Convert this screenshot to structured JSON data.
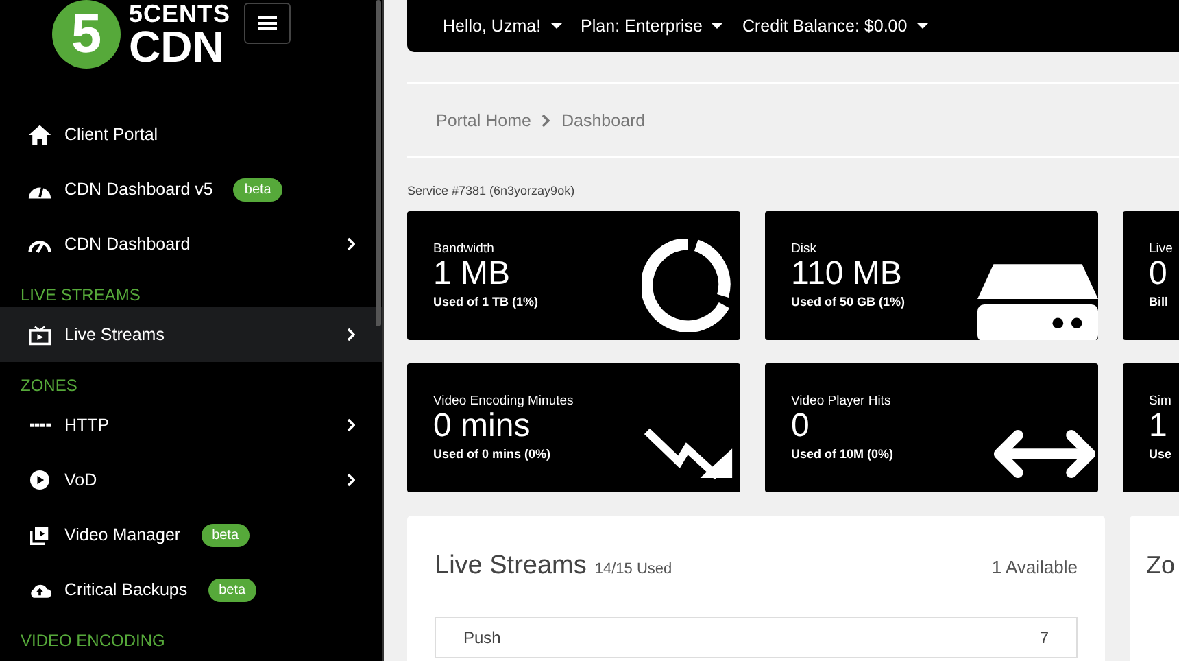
{
  "sidebar": {
    "logo": {
      "mark": "5",
      "line_1": "5CENTS",
      "line_2": "CDN"
    },
    "items": [
      {
        "kind": "link",
        "label": "Client Portal",
        "selected": false
      },
      {
        "kind": "link",
        "label": "CDN Dashboard v5",
        "badge": "beta",
        "selected": false
      },
      {
        "kind": "link",
        "label": "CDN Dashboard",
        "chevron": true,
        "selected": false
      },
      {
        "kind": "header",
        "label": "LIVE STREAMS"
      },
      {
        "kind": "link",
        "label": "Live Streams",
        "chevron": true,
        "selected": true
      },
      {
        "kind": "header",
        "label": "ZONES"
      },
      {
        "kind": "link",
        "label": "HTTP",
        "chevron": true,
        "selected": false
      },
      {
        "kind": "link",
        "label": "VoD",
        "chevron": true,
        "selected": false
      },
      {
        "kind": "link",
        "label": "Video Manager",
        "badge": "beta",
        "selected": false
      },
      {
        "kind": "link",
        "label": "Critical Backups",
        "badge": "beta",
        "selected": false
      },
      {
        "kind": "header",
        "label": "VIDEO ENCODING"
      }
    ]
  },
  "top_bar": {
    "menus": [
      "Hello, Uzma!",
      "Plan: Enterprise",
      "Credit Balance: $0.00"
    ]
  },
  "breadcrumb": [
    "Portal Home",
    "Dashboard"
  ],
  "service": "Service #7381 (6n3yorzay9ok)",
  "stats": [
    {
      "label": "Bandwidth",
      "value": "1 MB",
      "sub": "Used of 1 TB (1%)"
    },
    {
      "label": "Disk",
      "value": "110 MB",
      "sub": "Used of 50 GB (1%)"
    },
    {
      "label": "Live",
      "value": "0",
      "sub": "Bill"
    },
    {
      "label": "Video Encoding Minutes",
      "value": "0 mins",
      "sub": "Used of 0 mins (0%)"
    },
    {
      "label": "Video Player Hits",
      "value": "0",
      "sub": "Used of 10M (0%)"
    },
    {
      "label": "Sim",
      "value": "1",
      "sub": "Use"
    }
  ],
  "panels": [
    {
      "title": "Live Streams",
      "count": "14/15 Used",
      "available": "1 Available",
      "rows": [
        {
          "name": "Push",
          "value": "7"
        }
      ]
    },
    {
      "title": "Zo"
    }
  ]
}
